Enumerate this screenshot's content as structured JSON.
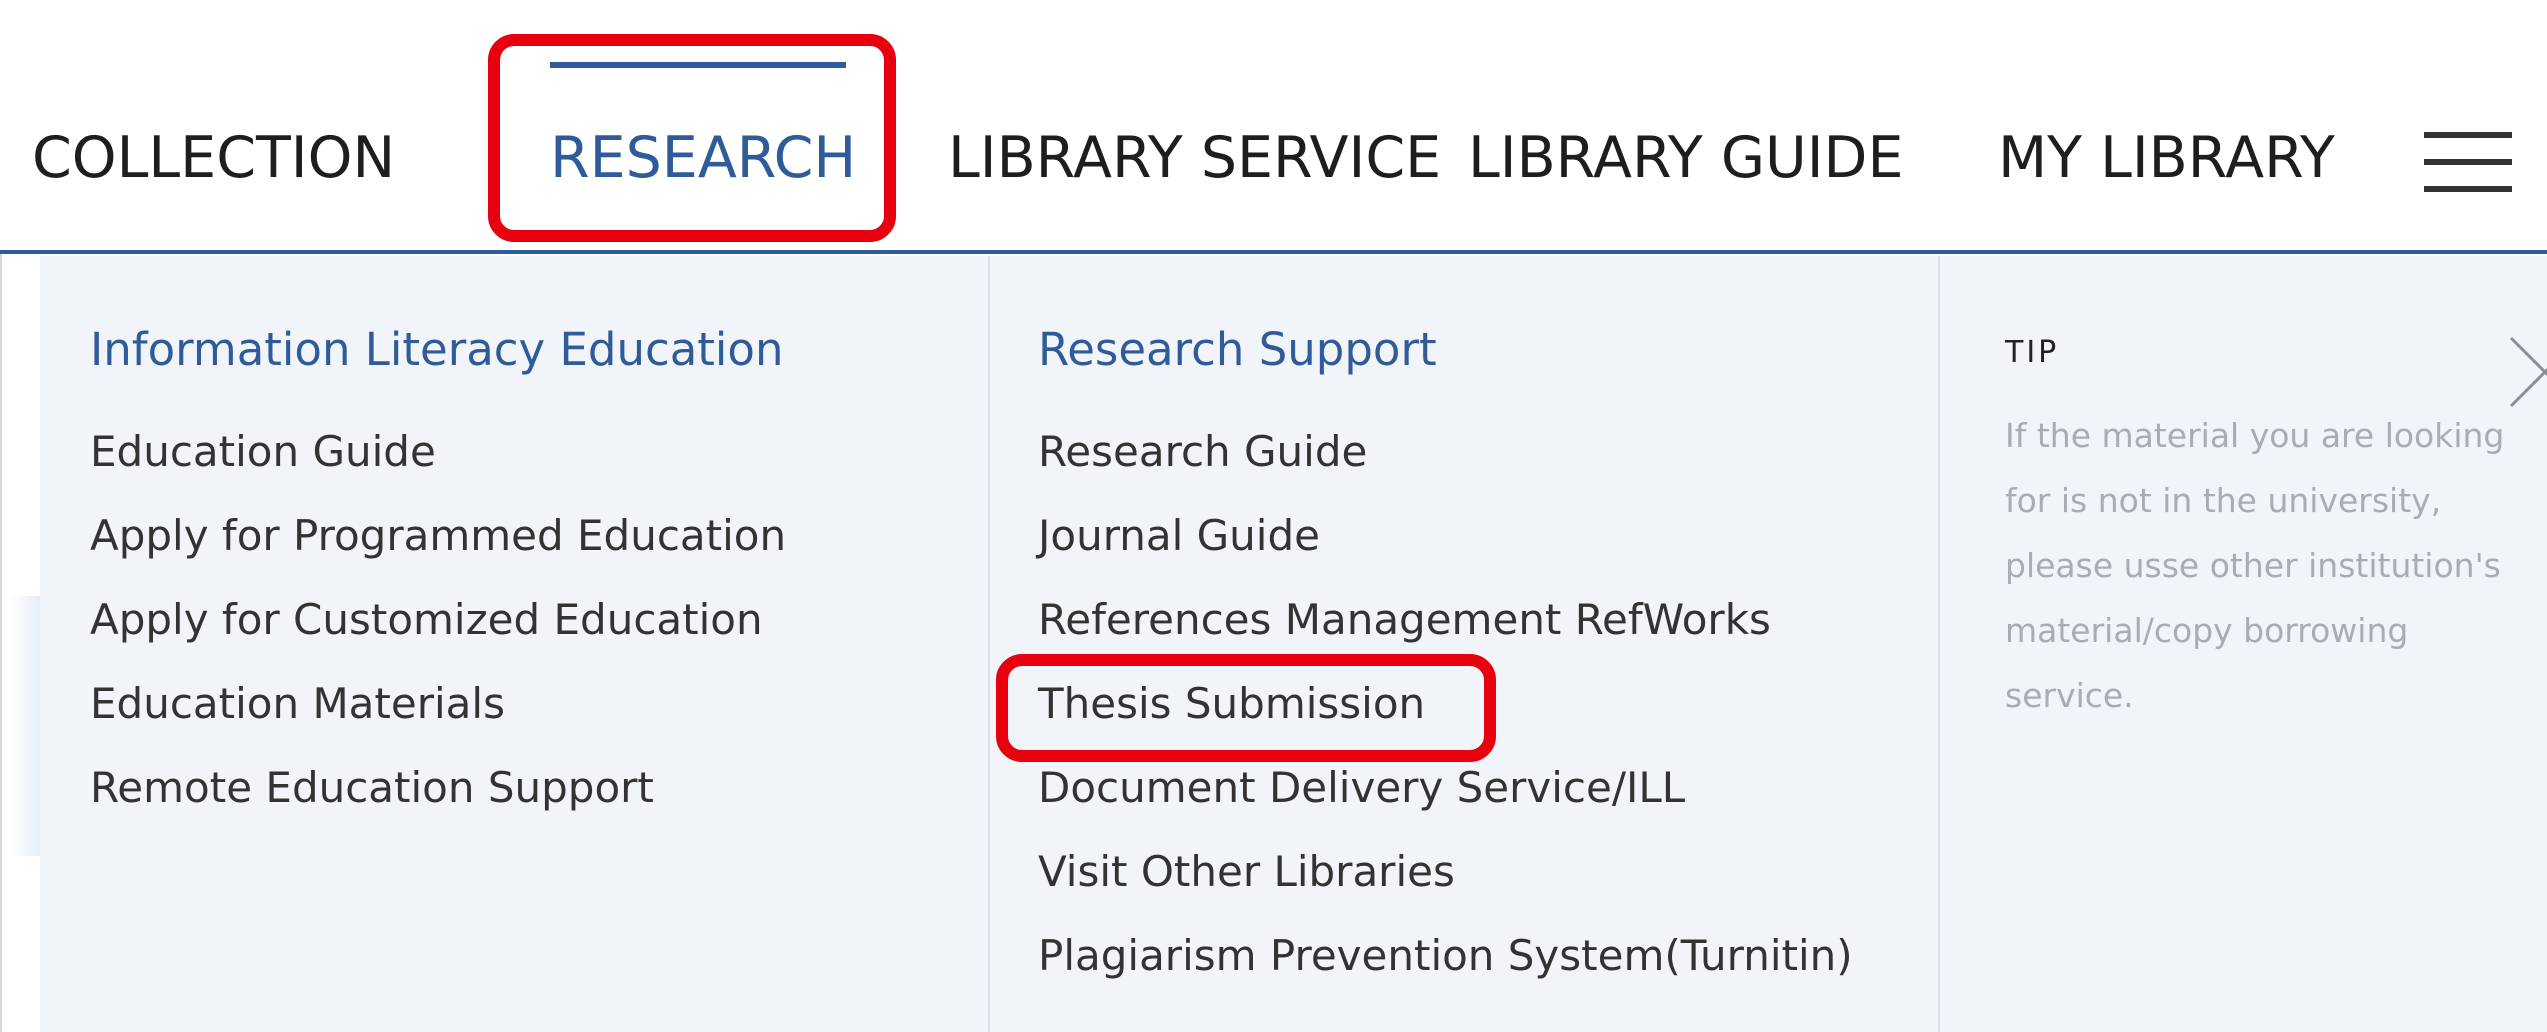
{
  "nav": {
    "items": [
      {
        "label": "COLLECTION"
      },
      {
        "label": "RESEARCH",
        "active": true
      },
      {
        "label": "LIBRARY SERVICE"
      },
      {
        "label": "LIBRARY GUIDE"
      },
      {
        "label": "MY LIBRARY"
      }
    ],
    "menu_icon": "hamburger-menu-icon"
  },
  "dropdown": {
    "columns": [
      {
        "title": "Information Literacy Education",
        "links": [
          "Education Guide",
          "Apply for Programmed Education",
          "Apply for Customized Education",
          "Education Materials",
          "Remote Education Support"
        ]
      },
      {
        "title": "Research Support",
        "links": [
          "Research Guide",
          "Journal Guide",
          "References Management RefWorks",
          "Thesis Submission",
          "Document Delivery Service/ILL",
          "Visit Other Libraries",
          "Plagiarism Prevention System(Turnitin)"
        ]
      }
    ],
    "tip": {
      "title": "TIP",
      "lines": [
        "If the material you are looking",
        "for is not in the university,",
        "please usse other institution's",
        "material/copy borrowing",
        "service."
      ],
      "close_icon": "close-icon"
    }
  },
  "colors": {
    "accent": "#2f5b9a",
    "highlight": "#e8000f",
    "panel_bg": "#f1f5f9",
    "tip_text": "#a6adb5"
  }
}
